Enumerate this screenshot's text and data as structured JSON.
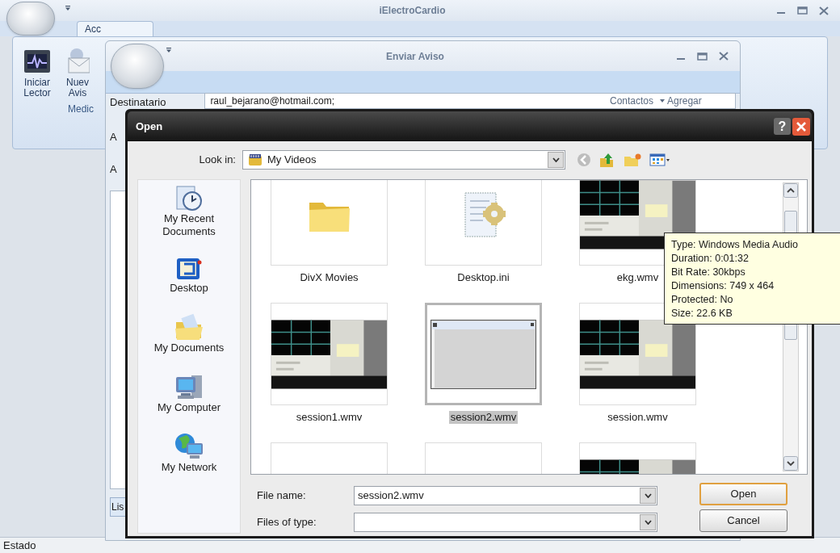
{
  "main_window": {
    "title": "iElectroCardio",
    "tab": "Acc",
    "ribbon_buttons": [
      {
        "kind": "monitor",
        "lines": [
          "Iniciar",
          "Lector"
        ]
      },
      {
        "kind": "mail",
        "lines": [
          "Nuev",
          "Avis"
        ]
      }
    ],
    "group_label": "Medic",
    "status": "Estado"
  },
  "enviar_aviso": {
    "title": "Enviar Aviso",
    "fields": [
      {
        "label": "Destinatario",
        "value": "raul_bejarano@hotmail.com;"
      },
      {
        "label": "A"
      },
      {
        "label": "A"
      }
    ],
    "contacts_link": "Contactos",
    "add_link": "Agregar",
    "list_tab": "Lis"
  },
  "open_dialog": {
    "title": "Open",
    "help": "?",
    "look_in_label": "Look in:",
    "look_in_value": "My Videos",
    "places": [
      {
        "kind": "recent",
        "label": "My Recent Documents"
      },
      {
        "kind": "desktop",
        "label": "Desktop"
      },
      {
        "kind": "documents",
        "label": "My Documents"
      },
      {
        "kind": "computer",
        "label": "My Computer"
      },
      {
        "kind": "network",
        "label": "My Network"
      }
    ],
    "files": [
      {
        "kind": "folder",
        "name": "DivX Movies",
        "selected": false
      },
      {
        "kind": "ini",
        "name": "Desktop.ini",
        "selected": false
      },
      {
        "kind": "video",
        "name": "ekg.wmv",
        "selected": false
      },
      {
        "kind": "video",
        "name": "session1.wmv",
        "selected": false
      },
      {
        "kind": "capture",
        "name": "session2.wmv",
        "selected": true
      },
      {
        "kind": "video",
        "name": "session.wmv",
        "selected": false
      },
      {
        "kind": "blank",
        "selected": false
      },
      {
        "kind": "blank",
        "selected": false
      },
      {
        "kind": "video",
        "selected": false
      }
    ],
    "file_name_label": "File name:",
    "file_name_value": "session2.wmv",
    "files_of_type_label": "Files of type:",
    "buttons": [
      "Open",
      "Cancel"
    ]
  },
  "tooltip": {
    "lines": [
      "Type: Windows Media Audio",
      "Duration: 0:01:32",
      "Bit Rate: 30kbps",
      "Dimensions: 749 x 464",
      "Protected: No",
      "Size: 22.6 KB"
    ]
  }
}
